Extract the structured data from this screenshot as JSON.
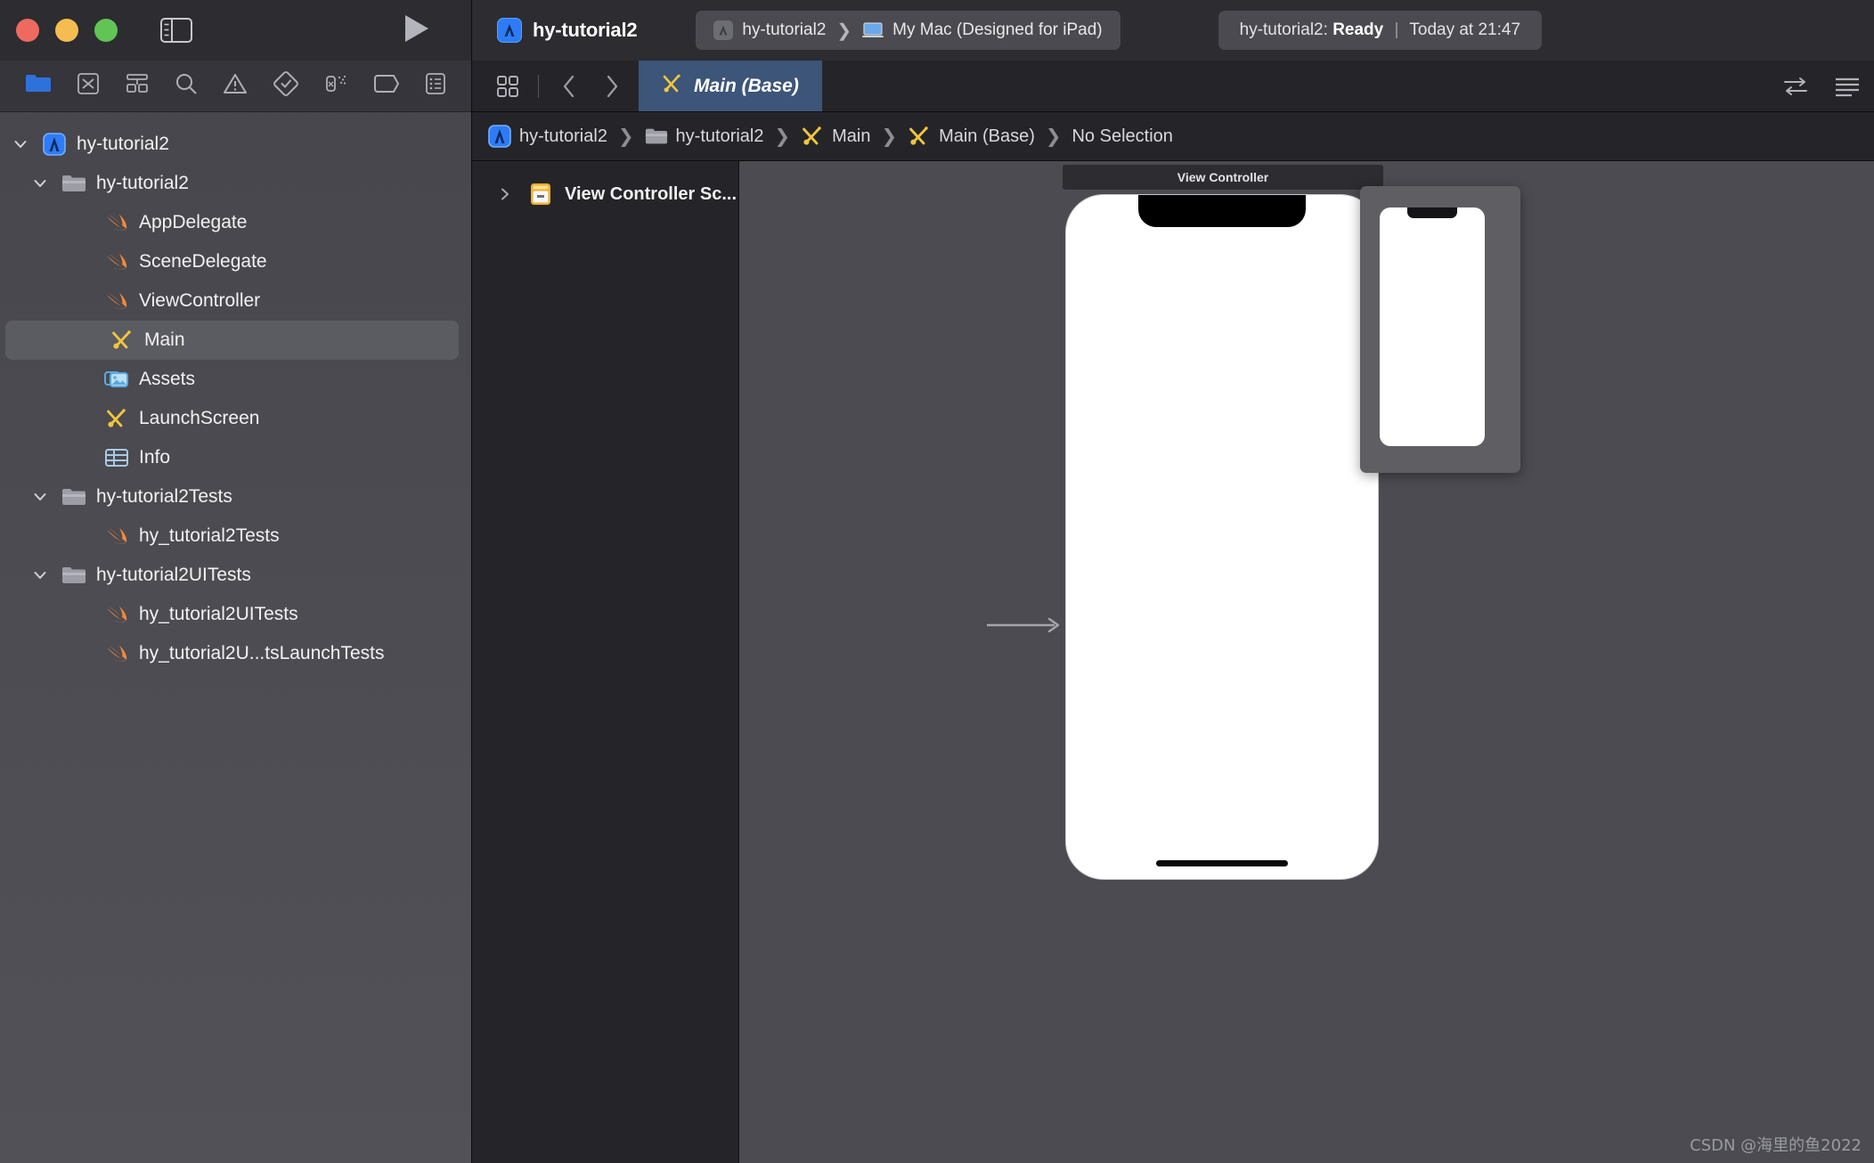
{
  "window": {
    "traffic_lights": [
      "close",
      "minimize",
      "zoom"
    ],
    "colors": {
      "red": "#ee6a5f",
      "yellow": "#f5bd4f",
      "green": "#61c454",
      "accent": "#2d7cf6",
      "tab_active": "#3c5578"
    }
  },
  "toolbar": {
    "project_name": "hy-tutorial2",
    "scheme": {
      "target": "hy-tutorial2",
      "destination": "My Mac (Designed for iPad)"
    },
    "status": {
      "prefix": "hy-tutorial2:",
      "state": "Ready",
      "separator": "|",
      "time": "Today at 21:47"
    },
    "sidebar_toggle_label": "Hide or show the Navigator",
    "run_label": "Start the active scheme"
  },
  "navigator": {
    "toolbar_icons": [
      "project-navigator-icon",
      "source-control-navigator-icon",
      "bookmarks-navigator-icon",
      "find-navigator-icon",
      "issue-navigator-icon",
      "test-navigator-icon",
      "debug-navigator-icon",
      "breakpoint-navigator-icon",
      "report-navigator-icon"
    ],
    "tree": [
      {
        "label": "hy-tutorial2",
        "icon": "xcode-project-icon",
        "indent": 0,
        "twisty": "down",
        "selected": false
      },
      {
        "label": "hy-tutorial2",
        "icon": "folder-icon",
        "indent": 1,
        "twisty": "down",
        "selected": false
      },
      {
        "label": "AppDelegate",
        "icon": "swift-file-icon",
        "indent": 2,
        "twisty": "none",
        "selected": false
      },
      {
        "label": "SceneDelegate",
        "icon": "swift-file-icon",
        "indent": 2,
        "twisty": "none",
        "selected": false
      },
      {
        "label": "ViewController",
        "icon": "swift-file-icon",
        "indent": 2,
        "twisty": "none",
        "selected": false
      },
      {
        "label": "Main",
        "icon": "storyboard-icon",
        "indent": 2,
        "twisty": "none",
        "selected": true
      },
      {
        "label": "Assets",
        "icon": "assets-catalog-icon",
        "indent": 2,
        "twisty": "none",
        "selected": false
      },
      {
        "label": "LaunchScreen",
        "icon": "storyboard-icon",
        "indent": 2,
        "twisty": "none",
        "selected": false
      },
      {
        "label": "Info",
        "icon": "plist-icon",
        "indent": 2,
        "twisty": "none",
        "selected": false
      },
      {
        "label": "hy-tutorial2Tests",
        "icon": "folder-icon",
        "indent": 1,
        "twisty": "down",
        "selected": false
      },
      {
        "label": "hy_tutorial2Tests",
        "icon": "swift-file-icon",
        "indent": 2,
        "twisty": "none",
        "selected": false
      },
      {
        "label": "hy-tutorial2UITests",
        "icon": "folder-icon",
        "indent": 1,
        "twisty": "down",
        "selected": false
      },
      {
        "label": "hy_tutorial2UITests",
        "icon": "swift-file-icon",
        "indent": 2,
        "twisty": "none",
        "selected": false
      },
      {
        "label": "hy_tutorial2U...tsLaunchTests",
        "icon": "swift-file-icon",
        "indent": 2,
        "twisty": "none",
        "selected": false
      }
    ]
  },
  "editor": {
    "tab_buttons": [
      "editor-options-icon",
      "back-chevron-icon",
      "forward-chevron-icon"
    ],
    "active_tab": {
      "label": "Main (Base)",
      "icon": "storyboard-icon"
    },
    "right_buttons": [
      "toggle-assistant-icon",
      "toggle-inspector-icon"
    ],
    "jumpbar": [
      {
        "label": "hy-tutorial2",
        "icon": "xcode-project-icon"
      },
      {
        "label": "hy-tutorial2",
        "icon": "folder-icon"
      },
      {
        "label": "Main",
        "icon": "storyboard-icon"
      },
      {
        "label": "Main (Base)",
        "icon": "storyboard-icon"
      },
      {
        "label": "No Selection",
        "icon": "none"
      }
    ]
  },
  "outline": {
    "items": [
      {
        "label": "View Controller Sc...",
        "icon": "view-controller-scene-icon",
        "twisty": "right"
      }
    ]
  },
  "canvas": {
    "scene_label": "View Controller",
    "device": "iPhone",
    "has_entry_arrow": true,
    "thumbnail_visible": true
  },
  "watermark": "CSDN @海里的鱼2022"
}
